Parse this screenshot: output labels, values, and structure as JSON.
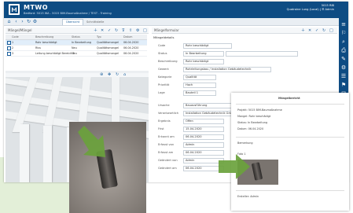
{
  "header": {
    "brand": "MTWO",
    "breadcrumb": "Bedford: 5015 WA - 5015 BIM-Baumaßnahme / TEST - Training",
    "company": "5015 RIB",
    "user": "Quatraine Lung (Local) | ☰ Admin"
  },
  "toolbar": {
    "tabs": [
      "Übersicht",
      "Schnittstelle"
    ]
  },
  "left_panel": {
    "title": "Mängel/Mängel",
    "columns": [
      "Code",
      "Beschreibung",
      "Status",
      "Typ",
      "Datum"
    ],
    "rows": [
      [
        "1",
        "Rohr beschädigt",
        "In Bearbeitung",
        "Qualitätsmangel",
        "06.04.2020"
      ],
      [
        "2",
        "Riss",
        "Neu",
        "Qualitätsmangel",
        "06.04.2020"
      ],
      [
        "3",
        "Leitung beschädigt Bereich 3",
        "Neu",
        "Qualitätsmangel",
        "06.04.2020"
      ]
    ]
  },
  "right_panel": {
    "title": "Mängelformular",
    "section": "Mängeldetails",
    "fields": [
      {
        "label": "Code",
        "value": "Rohr beschädigt"
      },
      {
        "label": "Status",
        "value": "In Bearbeitung"
      },
      {
        "label": "Beschreibung",
        "value": "Rohr beschädigt"
      },
      {
        "label": "Gewerk",
        "value": "Rohrleitungsbau / Installation Gebäudetechnik"
      },
      {
        "label": "Kategorie",
        "value": "Qualität"
      },
      {
        "label": "Priorität",
        "value": "Hoch"
      },
      {
        "label": "Lage",
        "value": "Bauteil 1"
      },
      {
        "label": "Ursache",
        "value": "Bauausführung"
      },
      {
        "label": "Verantwortlich",
        "value": "Installation Gebäudetechnik GmbH"
      },
      {
        "label": "Ergebnis",
        "value": "Offen"
      },
      {
        "label": "Frist",
        "value": "15.04.2020"
      },
      {
        "label": "Erkannt am",
        "value": "06.04.2020"
      },
      {
        "label": "Erfasst von",
        "value": "Admin"
      },
      {
        "label": "Erfasst am",
        "value": "06.04.2020"
      },
      {
        "label": "Geändert von",
        "value": "Admin"
      },
      {
        "label": "Geändert am",
        "value": "06.04.2020"
      }
    ]
  },
  "document": {
    "title": "Mängelbericht",
    "lines": [
      "Projekt: 5015 BIM-Baumaßnahme",
      "Mangel: Rohr beschädigt",
      "Status: In Bearbeitung",
      "Datum: 06.04.2020",
      "Bemerkung",
      "Foto 1",
      "Ersteller: Admin"
    ]
  },
  "colors": {
    "header": "#0e4c83",
    "accent": "#1b5f9c",
    "arrow": "#6aa23c",
    "marker": "#d42020",
    "background_panel": "#e3efd8"
  }
}
